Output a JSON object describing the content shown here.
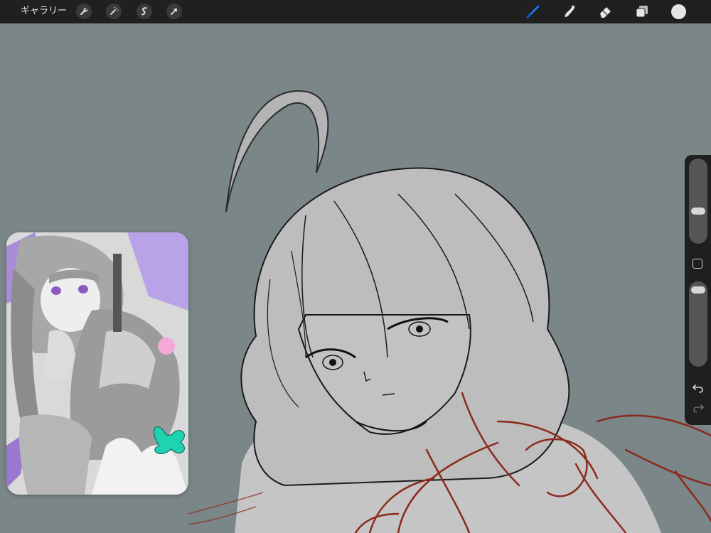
{
  "toolbar": {
    "gallery_label": "ギャラリー",
    "left_tools": [
      {
        "name": "actions",
        "icon": "wrench-icon"
      },
      {
        "name": "adjustments",
        "icon": "magic-wand-icon"
      },
      {
        "name": "selection",
        "icon": "selection-s-icon"
      },
      {
        "name": "transform",
        "icon": "arrow-cursor-icon"
      }
    ],
    "right_tools": [
      {
        "name": "brush",
        "icon": "brush-icon",
        "active": true
      },
      {
        "name": "smudge",
        "icon": "smudge-icon"
      },
      {
        "name": "eraser",
        "icon": "eraser-icon"
      },
      {
        "name": "layers",
        "icon": "layers-icon"
      },
      {
        "name": "color",
        "icon": "color-swatch"
      }
    ],
    "accent_color": "#1a7cff",
    "current_color": "#e6e6e6"
  },
  "canvas": {
    "background_color": "#7a8687",
    "sketch_line_color": "#1a1a1a",
    "rough_sketch_color": "#8b2a1c"
  },
  "reference_window": {
    "icon": "reference-image"
  },
  "sidebar": {
    "brush_size_level": 0.62,
    "opacity_level": 0.97,
    "icons": [
      "modify-square-icon",
      "undo-icon",
      "redo-icon"
    ]
  }
}
